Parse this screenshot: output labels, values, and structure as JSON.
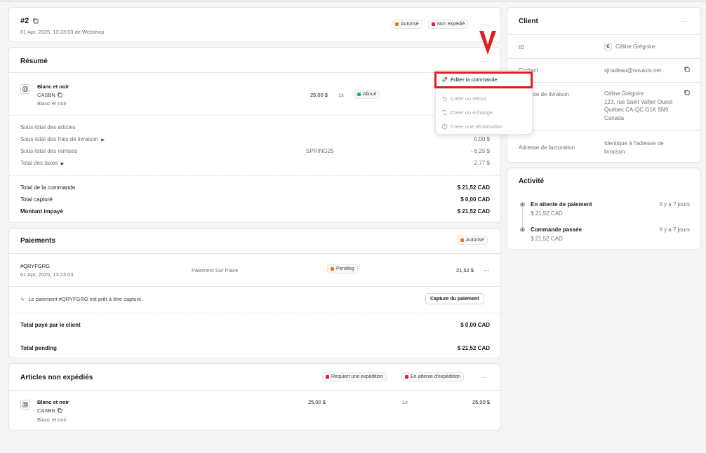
{
  "order": {
    "number": "#2",
    "subtitle": "01 Apr, 2025, 13:23:03 de Webshop",
    "badges": [
      {
        "label": "Autorisé",
        "color": "#f97316"
      },
      {
        "label": "Non expédié",
        "color": "#e11d48"
      }
    ]
  },
  "summary": {
    "title": "Résumé",
    "item": {
      "name": "Blanc et noir",
      "sku": "CASBN",
      "variant": "Blanc et noir",
      "price": "25,00 $",
      "qty": "1x",
      "status": "Alloué",
      "status_color": "#10b981"
    },
    "rows": [
      {
        "label": "Sous-total des articles",
        "mid": "",
        "value": ""
      },
      {
        "label": "Sous-total des frais de livraison",
        "mid": "",
        "value": "0,00 $"
      },
      {
        "label": "Sous-total des remises",
        "mid": "SPRING25",
        "value": "- 6,25 $"
      },
      {
        "label": "Total des taxes",
        "mid": "",
        "value": "2,77 $"
      }
    ],
    "totals": [
      {
        "label": "Total de la commande",
        "value": "$ 21,52 CAD"
      },
      {
        "label": "Total capturé",
        "value": "$ 0,00 CAD"
      },
      {
        "label": "Montant impayé",
        "value": "$ 21,52 CAD"
      }
    ]
  },
  "menu": {
    "items": [
      {
        "label": "Éditer la commande",
        "icon": "edit-icon"
      },
      {
        "label": "Créer un retour",
        "icon": "return-icon"
      },
      {
        "label": "Créer un échange",
        "icon": "exchange-icon"
      },
      {
        "label": "Créer une réclamation",
        "icon": "claim-icon"
      }
    ]
  },
  "payments": {
    "title": "Paiements",
    "badge": {
      "label": "Autorisé",
      "color": "#f97316"
    },
    "payment": {
      "id": "#QRYFGRG",
      "date": "01 Apr, 2025, 13:23:03",
      "method": "Paiement Sur Place",
      "status": "Pending",
      "status_color": "#f97316",
      "amount": "21,52 $"
    },
    "notice": "Le paiement #QRYFGRG est prêt à être capturé.",
    "capture_button": "Capture du paiement",
    "paid_label": "Total payé par le client",
    "paid_value": "$ 0,00 CAD",
    "pending_label": "Total pending",
    "pending_value": "$ 21,52 CAD"
  },
  "unshipped": {
    "title": "Articles non expédiés",
    "badges": [
      {
        "label": "Requiert une expédition",
        "color": "#e11d48"
      },
      {
        "label": "En attente d'expédition",
        "color": "#e11d48"
      }
    ],
    "item": {
      "name": "Blanc et noir",
      "sku": "CASBN",
      "variant": "Blanc et noir",
      "price": "25,00 $",
      "qty": "1x",
      "total": "25,00 $"
    }
  },
  "client": {
    "title": "Client",
    "id_label": "ID",
    "avatar_letter": "C",
    "name": "Céline Grégoire",
    "contact_label": "Contact",
    "email": "sjnadeau@novaxis.net",
    "shipping_label": "Adresse de livraison",
    "shipping_lines": [
      "Céline Grégoire",
      "123, rue Saint Vallier Ouest",
      "Québec CA-QC G1K 5N9",
      "Canada"
    ],
    "billing_label": "Adresse de facturation",
    "billing_lines": [
      "Identique à l'adresse de",
      "livraison"
    ]
  },
  "activity": {
    "title": "Activité",
    "events": [
      {
        "title": "En attente de paiement",
        "amount": "$ 21,52 CAD",
        "time": "Il y a 7 jours"
      },
      {
        "title": "Commande passée",
        "amount": "$ 21,52 CAD",
        "time": "Il y a 7 jours"
      }
    ]
  },
  "colors": {
    "highlight": "#e11d1d",
    "accent": "#18181b"
  }
}
